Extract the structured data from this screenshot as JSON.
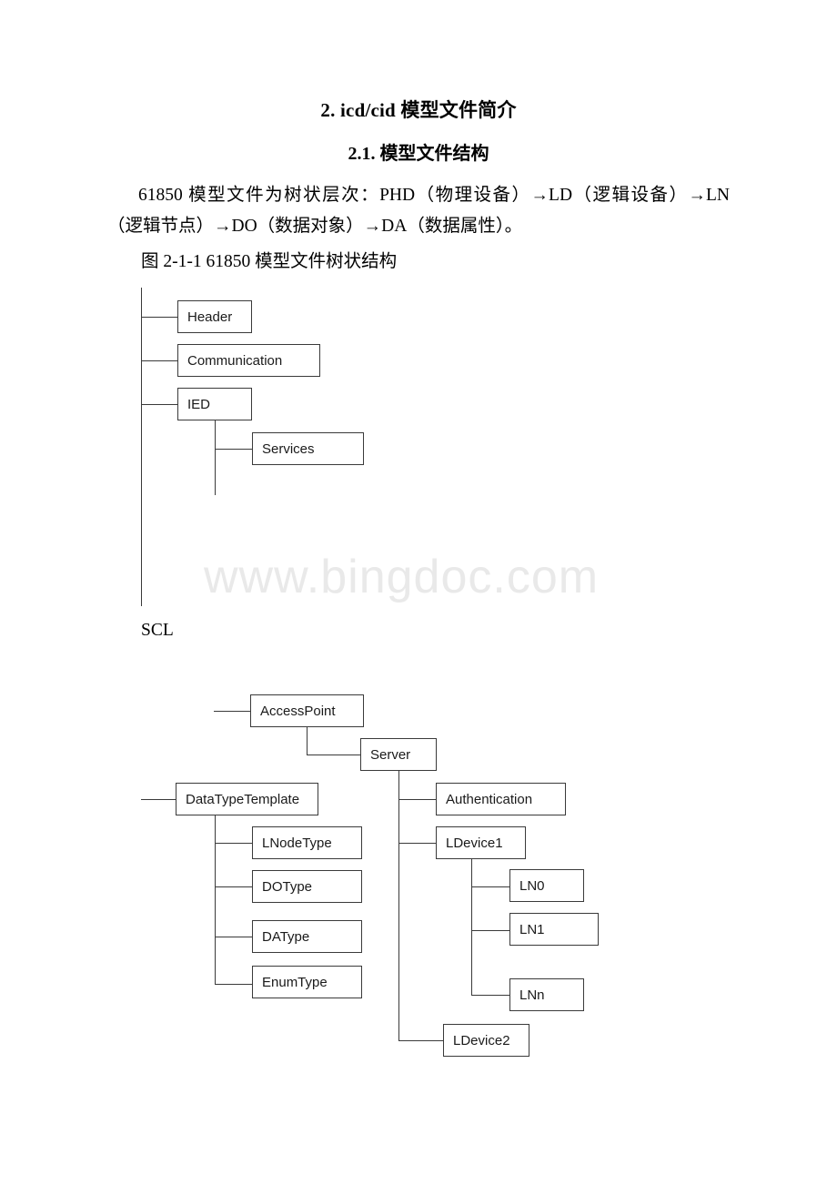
{
  "document": {
    "heading_1": "2. icd/cid 模型文件简介",
    "heading_2": "2.1. 模型文件结构",
    "paragraph": "61850 模型文件为树状层次：PHD（物理设备）→LD（逻辑设备）→LN（逻辑节点）→DO（数据对象）→DA（数据属性）。",
    "figure_caption": "图 2-1-1 61850 模型文件树状结构",
    "scl_label": "SCL",
    "watermark": "www.bingdoc.com",
    "watermark_color": "#e9e9e9"
  },
  "diagram_top": {
    "nodes": [
      {
        "id": "header",
        "label": "Header"
      },
      {
        "id": "communication",
        "label": "Communication"
      },
      {
        "id": "ied",
        "label": "IED"
      },
      {
        "id": "services",
        "label": "Services"
      }
    ]
  },
  "diagram_bottom": {
    "nodes": [
      {
        "id": "accesspoint",
        "label": "AccessPoint"
      },
      {
        "id": "server",
        "label": "Server"
      },
      {
        "id": "datatypetemplate",
        "label": "DataTypeTemplate"
      },
      {
        "id": "authentication",
        "label": "Authentication"
      },
      {
        "id": "lnodetype",
        "label": "LNodeType"
      },
      {
        "id": "ldevice1",
        "label": "LDevice1"
      },
      {
        "id": "dotype",
        "label": "DOType"
      },
      {
        "id": "ln0",
        "label": "LN0"
      },
      {
        "id": "datype",
        "label": "DAType"
      },
      {
        "id": "ln1",
        "label": "LN1"
      },
      {
        "id": "enumtype",
        "label": "EnumType"
      },
      {
        "id": "lnn",
        "label": "LNn"
      },
      {
        "id": "ldevice2",
        "label": "LDevice2"
      }
    ]
  }
}
